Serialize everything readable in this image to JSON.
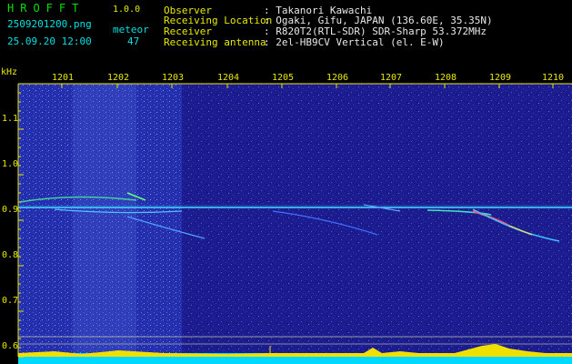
{
  "header": {
    "app_name": "HROFFT",
    "version": "1.0.0",
    "filename": "2509201200.png",
    "datetime": "25.09.20 12:00",
    "count_label": "meteor",
    "count_value": "47"
  },
  "info": [
    {
      "label": "Observer",
      "value": ": Takanori Kawachi"
    },
    {
      "label": "Receiving Location",
      "value": ": Ogaki, Gifu, JAPAN (136.60E, 35.35N)"
    },
    {
      "label": "Receiver",
      "value": ": R820T2(RTL-SDR) SDR-Sharp 53.372MHz"
    },
    {
      "label": "Receiving antenna",
      "value": ": 2el-HB9CV Vertical (el. E-W)"
    }
  ],
  "axes": {
    "y_unit": "kHz",
    "y_ticks": [
      "1.1",
      "1.0",
      "0.9",
      "0.8",
      "0.7",
      "0.6"
    ],
    "x_ticks": [
      "1201",
      "1202",
      "1203",
      "1204",
      "1205",
      "1206",
      "1207",
      "1208",
      "1209",
      "1210"
    ]
  },
  "colors": {
    "background": "#000000",
    "plot_background": "#1a1a8c",
    "header_green": "#00e000",
    "header_yellow": "#e8e800",
    "header_cyan": "#00e0e0",
    "carrier_line": "#40e0ff",
    "level_fill": "#00d8ff",
    "level_peak": "#f0e000"
  }
}
